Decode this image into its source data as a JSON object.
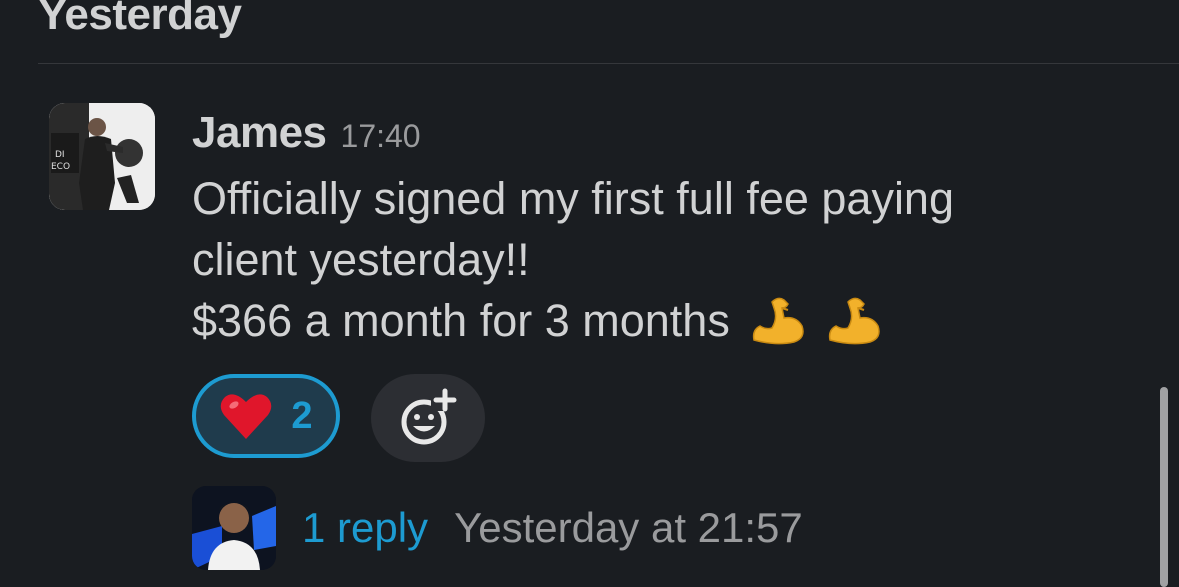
{
  "day_header": "Yesterday",
  "message": {
    "sender": "James",
    "time": "17:40",
    "lines": [
      "Officially signed my first full fee paying",
      "client yesterday!!",
      "$366 a month for 3 months"
    ],
    "trailing_emoji": [
      "flexed-biceps",
      "flexed-biceps"
    ]
  },
  "reactions": [
    {
      "emoji": "red-heart",
      "count": "2",
      "active": true
    }
  ],
  "add_reaction_icon": "add-reaction-icon",
  "thread": {
    "reply_label": "1 reply",
    "last_reply": "Yesterday at 21:57"
  },
  "colors": {
    "background": "#1a1d21",
    "text": "#d1d2d3",
    "muted": "#9a9b9d",
    "link": "#1d9bd1"
  }
}
